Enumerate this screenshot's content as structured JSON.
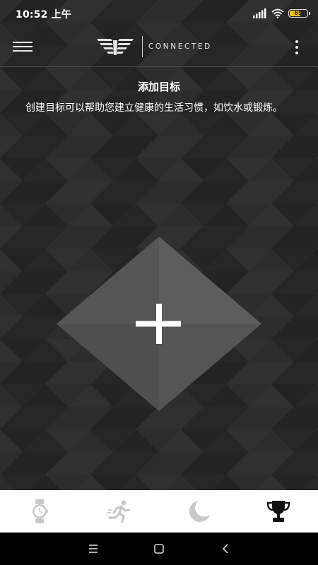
{
  "status_bar": {
    "time": "10:52 上午",
    "battery_level": "69",
    "battery_fraction": 0.69,
    "icons": [
      "signal-icon",
      "wifi-icon",
      "battery-icon"
    ]
  },
  "header": {
    "brand": "CONNECTED",
    "menu_icon": "hamburger-menu-icon",
    "more_icon": "more-vertical-icon",
    "logo_icon": "eagle-logo-icon"
  },
  "main": {
    "title": "添加目标",
    "description": "创建目标可以帮助您建立健康的生活习惯，如饮水或锻炼。",
    "add_icon": "plus-icon"
  },
  "tabs": [
    {
      "icon": "watch-icon",
      "active": false
    },
    {
      "icon": "running-icon",
      "active": false
    },
    {
      "icon": "moon-icon",
      "active": false
    },
    {
      "icon": "trophy-icon",
      "active": true
    }
  ],
  "system_nav": {
    "icons": [
      "menu-lines-icon",
      "home-square-icon",
      "back-chevron-icon"
    ]
  },
  "colors": {
    "background": "#2a2a2a",
    "accent_battery": "#f2c027",
    "tab_active": "#111111",
    "tab_inactive": "#c8c8c8"
  }
}
